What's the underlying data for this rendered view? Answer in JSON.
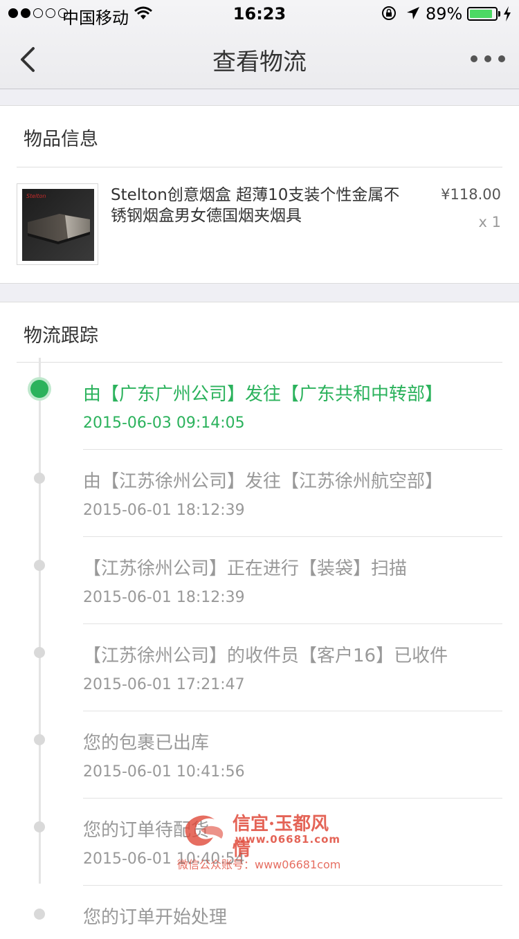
{
  "status_bar": {
    "carrier": "中国移动",
    "time": "16:23",
    "battery_percent": "89%",
    "battery_level": 0.89,
    "signal_bars_filled": 2,
    "signal_bars_total": 5,
    "battery_color": "#4cd964"
  },
  "nav": {
    "title": "查看物流",
    "back_icon": "chevron-left-icon",
    "more_icon": "more-dots-icon"
  },
  "goods": {
    "section_title": "物品信息",
    "product": {
      "name": "Stelton创意烟盒 超薄10支装个性金属不锈钢烟盒男女德国烟夹烟具",
      "price": "¥118.00",
      "quantity": "x 1",
      "image_brand_text": "Stelton"
    }
  },
  "tracking": {
    "section_title": "物流跟踪",
    "active_color": "#2bb25c",
    "events": [
      {
        "description": "由【广东广州公司】发往【广东共和中转部】",
        "time": "2015-06-03 09:14:05",
        "active": true
      },
      {
        "description": "由【江苏徐州公司】发往【江苏徐州航空部】",
        "time": "2015-06-01 18:12:39",
        "active": false
      },
      {
        "description": "【江苏徐州公司】正在进行【装袋】扫描",
        "time": "2015-06-01 18:12:39",
        "active": false
      },
      {
        "description": "【江苏徐州公司】的收件员【客户16】已收件",
        "time": "2015-06-01 17:21:47",
        "active": false
      },
      {
        "description": "您的包裹已出库",
        "time": "2015-06-01 10:41:56",
        "active": false
      },
      {
        "description": "您的订单待配货",
        "time": "2015-06-01 10:40:54",
        "active": false
      },
      {
        "description": "您的订单开始处理",
        "time": "",
        "active": false
      }
    ]
  },
  "watermark": {
    "title": "信宜·玉都风情",
    "site": "www.06681.com",
    "subtitle": "微信公众账号：www06681com"
  }
}
